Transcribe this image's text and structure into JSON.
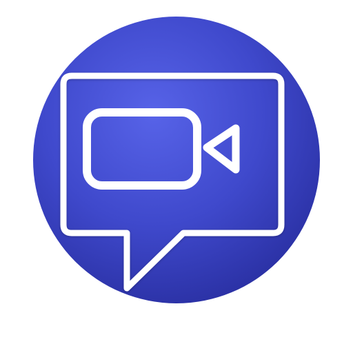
{
  "app_icon": {
    "icon_name": "video-chat-icon",
    "colors": {
      "background": "#ffffff",
      "circle_light": "#5763e8",
      "circle_mid": "#3f49cc",
      "circle_dark": "#2a30a3",
      "stroke": "#ffffff"
    }
  }
}
